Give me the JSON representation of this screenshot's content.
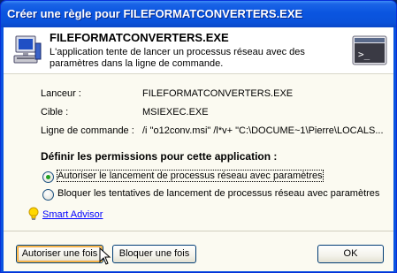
{
  "window": {
    "title": "Créer une règle pour FILEFORMATCONVERTERS.EXE"
  },
  "header": {
    "app_name": "FILEFORMATCONVERTERS.EXE",
    "description": "L'application tente de lancer un processus réseau avec des paramètres dans la ligne de commande."
  },
  "details": {
    "launcher_label": "Lanceur :",
    "launcher_value": "FILEFORMATCONVERTERS.EXE",
    "target_label": "Cible :",
    "target_value": "MSIEXEC.EXE",
    "cmdline_label": "Ligne de commande :",
    "cmdline_value": "/i \"o12conv.msi\" /l*v+ \"C:\\DOCUME~1\\Pierre\\LOCALS..."
  },
  "permissions": {
    "title": "Définir les permissions pour cette application :",
    "options": [
      {
        "label": "Autoriser le lancement de processus réseau avec paramètres",
        "selected": true
      },
      {
        "label": "Bloquer les tentatives de lancement de processus réseau avec paramètres",
        "selected": false
      }
    ]
  },
  "advisor": {
    "label": "Smart Advisor",
    "icon": "lightbulb-icon"
  },
  "buttons": {
    "allow_once": "Autoriser une fois",
    "block_once": "Bloquer une fois",
    "ok": "OK"
  },
  "colors": {
    "title_bar": "#0a55e0",
    "selected_radio": "#21a121",
    "link": "#0000ff"
  }
}
